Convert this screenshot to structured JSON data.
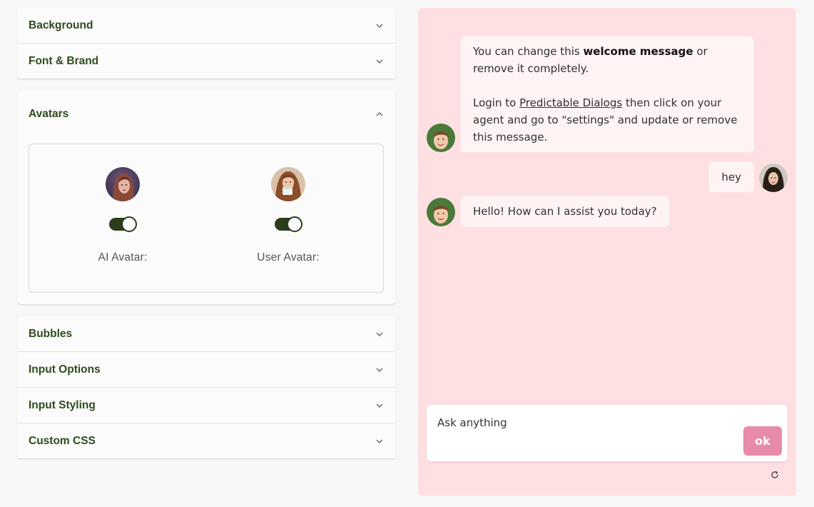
{
  "settings": {
    "top_items": [
      {
        "label": "Background"
      },
      {
        "label": "Font & Brand"
      }
    ],
    "avatars": {
      "title": "Avatars",
      "ai_label": "AI Avatar:",
      "user_label": "User Avatar:",
      "ai_enabled": true,
      "user_enabled": true
    },
    "bottom_items": [
      {
        "label": "Bubbles"
      },
      {
        "label": "Input Options"
      },
      {
        "label": "Input Styling"
      },
      {
        "label": "Custom CSS"
      }
    ]
  },
  "chat": {
    "welcome": {
      "p1_pre": "You can change this ",
      "p1_bold": "welcome message",
      "p1_post": " or remove it completely.",
      "p2_pre": "Login to ",
      "p2_link": "Predictable Dialogs",
      "p2_post": " then click on your agent and go to \"settings\" and update or remove this message."
    },
    "user_message": "hey",
    "bot_reply": "Hello! How can I assist you today?",
    "input_placeholder": "Ask anything",
    "send_label": "ok"
  },
  "colors": {
    "accent_green": "#2f4a1f",
    "chat_bg": "#ffe0e2",
    "send_button": "#e88ba8"
  },
  "icons": {
    "collapsed": "chevron-down-icon",
    "expanded": "chevron-up-icon",
    "reset": "refresh-icon"
  }
}
